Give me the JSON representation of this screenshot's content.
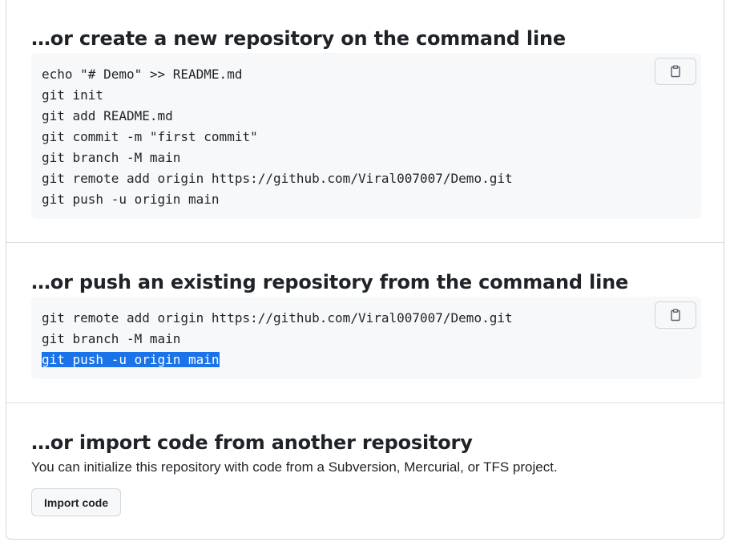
{
  "sections": [
    {
      "title": "…or create a new repository on the command line",
      "lines": [
        "echo \"# Demo\" >> README.md",
        "git init",
        "git add README.md",
        "git commit -m \"first commit\"",
        "git branch -M main",
        "git remote add origin https://github.com/Viral007007/Demo.git",
        "git push -u origin main"
      ],
      "copy_icon": "clipboard-icon"
    },
    {
      "title": "…or push an existing repository from the command line",
      "lines": [
        "git remote add origin https://github.com/Viral007007/Demo.git",
        "git branch -M main",
        "git push -u origin main"
      ],
      "selected_line": 2,
      "copy_icon": "clipboard-icon"
    },
    {
      "title": "…or import code from another repository",
      "description": "You can initialize this repository with code from a Subversion, Mercurial, or TFS project.",
      "button_label": "Import code"
    }
  ],
  "colors": {
    "selection": "#1a73e8",
    "code_background": "#f6f8fa",
    "border": "#d0d7de"
  }
}
